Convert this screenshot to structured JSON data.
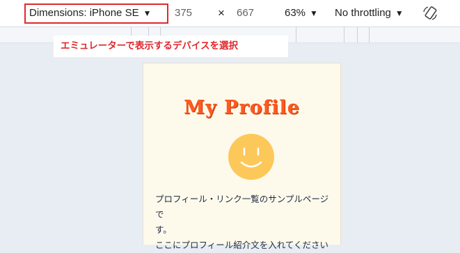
{
  "toolbar": {
    "dimensions_label": "Dimensions: iPhone SE",
    "width_value": "375",
    "times_sign": "×",
    "height_value": "667",
    "zoom_label": "63%",
    "throttling_label": "No throttling"
  },
  "annotation": {
    "text": "エミュレーターで表示するデバイスを選択",
    "color": "#e0282d"
  },
  "page": {
    "title": "My Profile",
    "intro_line1": "プロフィール・リンク一覧のサンプルページで",
    "intro_line2": "す。",
    "intro_line3": "ここにプロフィール紹介文を入れてください"
  },
  "icons": {
    "dropdown": "caret-down-icon",
    "rotate": "rotate-icon",
    "avatar": "smiley-face-icon"
  }
}
